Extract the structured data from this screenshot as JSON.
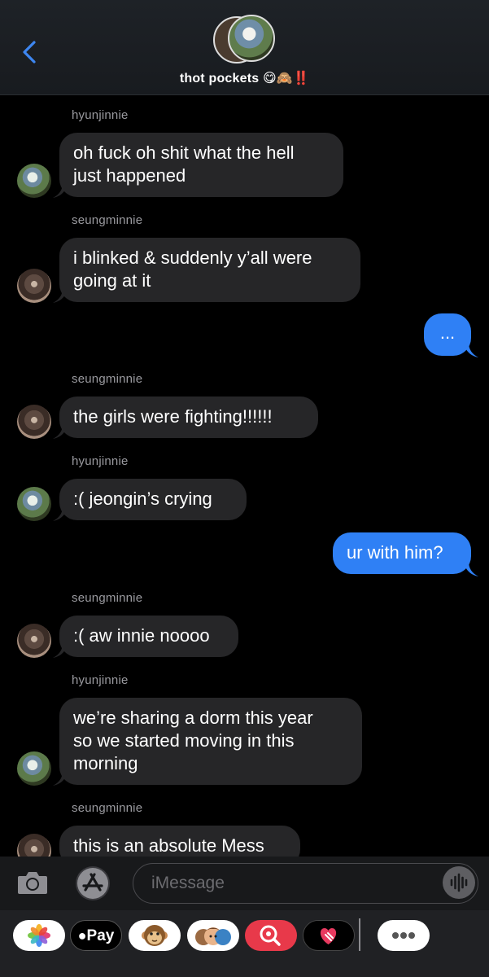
{
  "header": {
    "back_label": "back",
    "group_name": "thot pockets",
    "group_emoji": "😋🙈",
    "group_marks": "‼️"
  },
  "messages": [
    {
      "sender": "hyunjinnie",
      "text_lines": [
        "oh fuck oh shit what the hell",
        "just happened"
      ]
    },
    {
      "sender": "seungminnie",
      "text_lines": [
        "i blinked & suddenly y’all were",
        "going at it"
      ]
    },
    {
      "sender": "me",
      "text_lines": [
        "..."
      ]
    },
    {
      "sender": "seungminnie",
      "text_lines": [
        "the girls were fighting!!!!!!"
      ]
    },
    {
      "sender": "hyunjinnie",
      "text_lines": [
        ":( jeongin’s crying"
      ]
    },
    {
      "sender": "me",
      "text_lines": [
        "ur with him?"
      ]
    },
    {
      "sender": "seungminnie",
      "text_lines": [
        ":( aw innie noooo"
      ]
    },
    {
      "sender": "hyunjinnie",
      "text_lines": [
        "we’re sharing a dorm this year",
        "so we started moving in this",
        "morning"
      ]
    },
    {
      "sender": "seungminnie",
      "text_lines": [
        "this is an absolute Mess"
      ]
    }
  ],
  "input": {
    "placeholder": "iMessage"
  },
  "apps": {
    "applepay_label": "Pay"
  },
  "colors": {
    "outgoing_bubble": "#2f80f5",
    "incoming_bubble": "#262628",
    "accent": "#2f80f5"
  }
}
